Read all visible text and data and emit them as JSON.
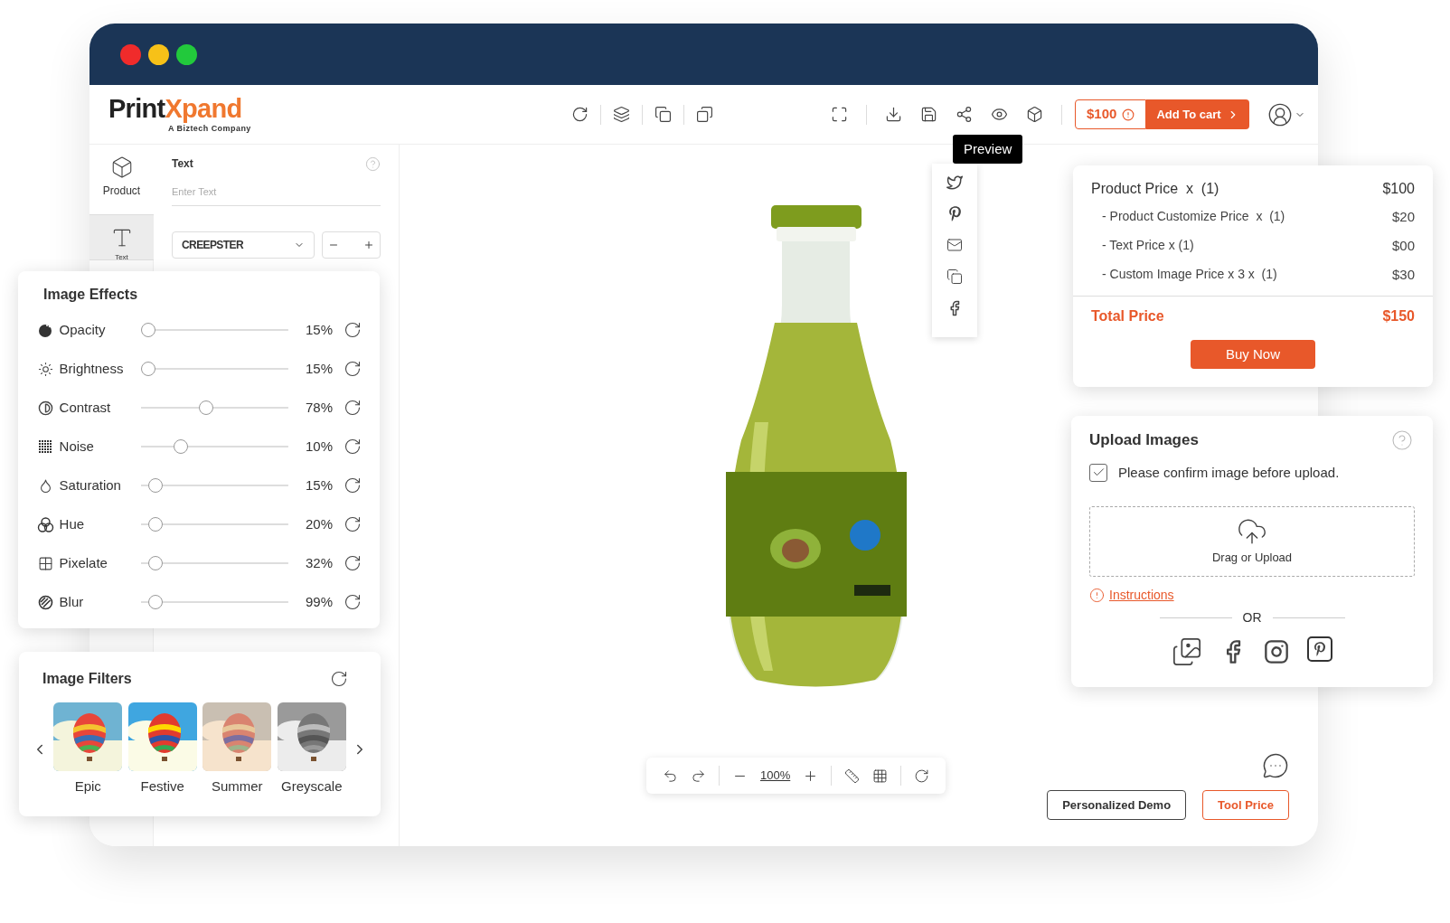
{
  "logo": {
    "primary": "Print",
    "accent": "Xpand",
    "tagline": "A Biztech Company"
  },
  "header": {
    "price": "$100",
    "cart": "Add To cart"
  },
  "tooltip": {
    "label": "Preview"
  },
  "sidebar": {
    "items": [
      {
        "label": "Product",
        "kind": "product",
        "selected": false
      },
      {
        "label": "Text",
        "kind": "text",
        "selected": true
      }
    ]
  },
  "text_panel": {
    "title": "Text",
    "placeholder": "Enter Text",
    "font": "CREEPSTER"
  },
  "image_effects": {
    "title": "Image Effects",
    "effects": [
      {
        "label": "Opacity",
        "kind": "opacity",
        "level": 0.05,
        "reading": "15%"
      },
      {
        "label": "Brightness",
        "kind": "brightness",
        "level": 0.05,
        "reading": "15%"
      },
      {
        "label": "Contrast",
        "kind": "contrast",
        "level": 0.44,
        "reading": "78%"
      },
      {
        "label": "Noise",
        "kind": "noise",
        "level": 0.27,
        "reading": "10%"
      },
      {
        "label": "Saturation",
        "kind": "saturation",
        "level": 0.1,
        "reading": "15%"
      },
      {
        "label": "Hue",
        "kind": "hue",
        "level": 0.1,
        "reading": "20%"
      },
      {
        "label": "Pixelate",
        "kind": "pixelate",
        "level": 0.1,
        "reading": "32%"
      },
      {
        "label": "Blur",
        "kind": "blur",
        "level": 0.1,
        "reading": "99%"
      }
    ]
  },
  "image_filters": {
    "title": "Image Filters",
    "filters": [
      {
        "label": "Epic"
      },
      {
        "label": "Festive"
      },
      {
        "label": "Summer"
      },
      {
        "label": "Greyscale"
      }
    ]
  },
  "price_panel": {
    "lines": [
      {
        "label": "Product Price  x  (1)",
        "amount": "$100",
        "kind": "main"
      },
      {
        "label": "- Product Customize Price  x  (1)",
        "amount": "$20",
        "kind": "sub"
      },
      {
        "label": "- Text Price x (1)",
        "amount": "$00",
        "kind": "sub"
      },
      {
        "label": "- Custom Image Price x 3 x  (1)",
        "amount": "$30",
        "kind": "sub"
      }
    ],
    "total_label": "Total Price",
    "total_amount": "$150",
    "button": "Buy Now"
  },
  "upload_panel": {
    "title": "Upload Images",
    "confirm": {
      "label": "Please confirm image before upload.",
      "checked": true
    },
    "dropzone": "Drag or Upload",
    "instructions": "Instructions",
    "separator": "OR"
  },
  "canvas_toolbar": {
    "zoom": "100%"
  },
  "footer_buttons": [
    "Personalized Demo",
    "Tool Price"
  ]
}
